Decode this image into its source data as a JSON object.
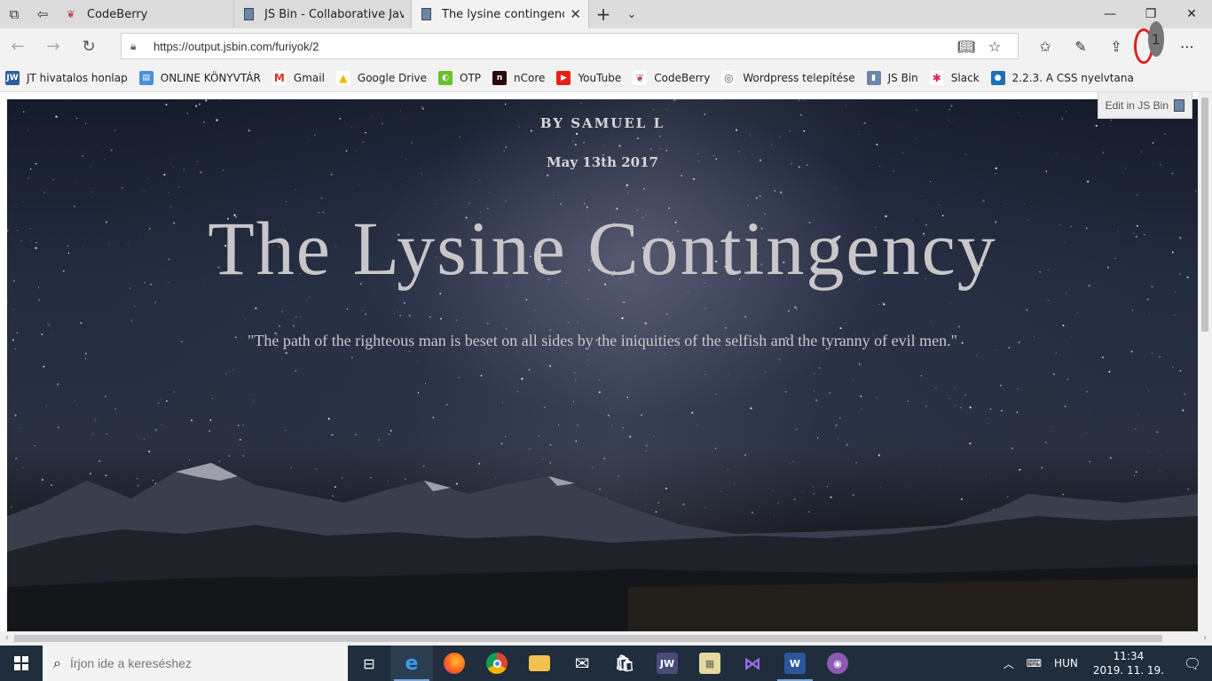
{
  "browser": {
    "tabs": [
      {
        "title": "CodeBerry",
        "active": false
      },
      {
        "title": "JS Bin - Collaborative JavaScript Debugging",
        "active": false
      },
      {
        "title": "The lysine contingency",
        "active": true
      }
    ],
    "url": "https://output.jsbin.com/furiyok/2",
    "favorites": [
      {
        "label": "JT hivatalos honlap",
        "icon": "jw-icon",
        "color": "#2f5d9e",
        "glyph": "JW"
      },
      {
        "label": "ONLINE KÖNYVTÁR",
        "icon": "library-icon",
        "color": "#4a90d9",
        "glyph": "▤"
      },
      {
        "label": "Gmail",
        "icon": "gmail-icon",
        "color": "#ffffff",
        "glyph": "M"
      },
      {
        "label": "Google Drive",
        "icon": "google-drive-icon",
        "color": "#ffffff",
        "glyph": "▲"
      },
      {
        "label": "OTP",
        "icon": "otp-icon",
        "color": "#6cbf2e",
        "glyph": "◐"
      },
      {
        "label": "nCore",
        "icon": "ncore-icon",
        "color": "#2a0a0a",
        "glyph": "n"
      },
      {
        "label": "YouTube",
        "icon": "youtube-icon",
        "color": "#e62117",
        "glyph": "▶"
      },
      {
        "label": "CodeBerry",
        "icon": "codeberry-icon",
        "color": "#ffffff",
        "glyph": "❦"
      },
      {
        "label": "Wordpress telepítése",
        "icon": "wordpress-icon",
        "color": "#ffffff",
        "glyph": "◎"
      },
      {
        "label": "JS Bin",
        "icon": "jsbin-icon",
        "color": "#6b87a8",
        "glyph": "▮"
      },
      {
        "label": "Slack",
        "icon": "slack-icon",
        "color": "#ffffff",
        "glyph": "✱"
      },
      {
        "label": "2.2.3. A CSS nyelvtana",
        "icon": "drupal-icon",
        "color": "#1f6fb5",
        "glyph": "●"
      }
    ]
  },
  "page": {
    "author": "BY SAMUEL L",
    "date": "May 13th 2017",
    "title": "The Lysine Contingency",
    "quote": "\"The path of the righteous man is beset on all sides by the iniquities of the selfish and the tyranny of evil men.\"",
    "edit_label": "Edit in JS Bin"
  },
  "taskbar": {
    "search_placeholder": "Írjon ide a kereséshez",
    "language": "HUN",
    "time": "11:34",
    "date": "2019. 11. 19."
  }
}
